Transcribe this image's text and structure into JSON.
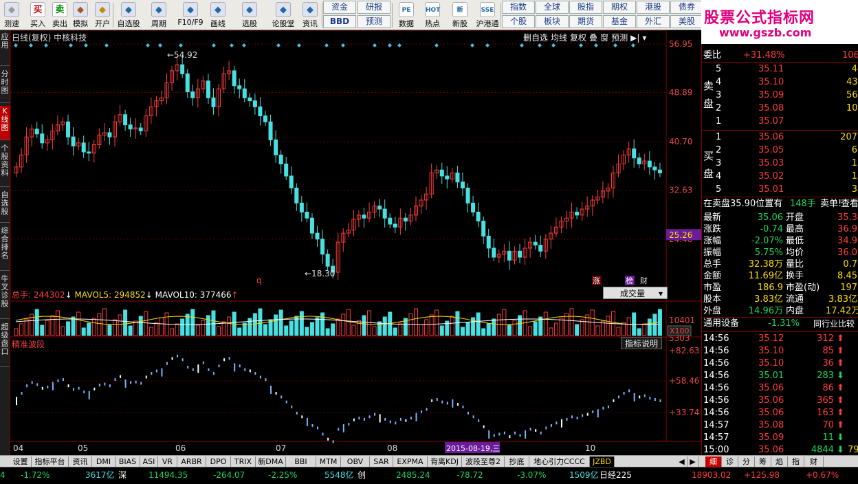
{
  "toolbar": {
    "buttons": [
      {
        "label": "测速",
        "icon": "speed-icon"
      },
      {
        "label": "买入",
        "icon": "buy-icon",
        "glyph": "买"
      },
      {
        "label": "卖出",
        "icon": "sell-icon",
        "glyph": "卖"
      },
      {
        "label": "模拟",
        "icon": "hammer-icon"
      },
      {
        "label": "开户",
        "icon": "lock-icon"
      },
      {
        "label": "自选股",
        "icon": "star-icon"
      },
      {
        "label": "周期",
        "icon": "clock-icon"
      },
      {
        "label": "F10/F9",
        "icon": "f10-icon"
      },
      {
        "label": "画线",
        "icon": "pen-icon"
      },
      {
        "label": "选股",
        "icon": "screen-icon"
      },
      {
        "label": "论股堂",
        "icon": "forum-icon"
      },
      {
        "label": "资讯",
        "icon": "news-icon"
      }
    ],
    "small_row1": [
      "资金",
      "研报"
    ],
    "small_row2": [
      "BBD",
      "预测"
    ],
    "buttons2": [
      {
        "label": "数据",
        "glyph": "PE"
      },
      {
        "label": "热点",
        "glyph": "HOT"
      },
      {
        "label": "新股",
        "glyph": "新"
      },
      {
        "label": "沪港通",
        "glyph": "SSE"
      }
    ],
    "grid_row1": [
      "指数",
      "全球",
      "股指",
      "期权",
      "港股",
      "债券"
    ],
    "grid_row2": [
      "个股",
      "板块",
      "期货",
      "基金",
      "外汇",
      "美股"
    ]
  },
  "watermark": {
    "title": "股票公式指标网",
    "url": "www.gszb.com"
  },
  "left_nav": [
    "应用",
    "分时图",
    "K线图",
    "个股资料",
    "自选股",
    "综合排名",
    "牛叉诊股",
    "超级盘口"
  ],
  "chart": {
    "header": "日线(复权) 中核科技",
    "tools": [
      "删自选",
      "均线",
      "复权",
      "叠",
      "窗",
      "预测"
    ],
    "max_label": "54.92",
    "min_label": "18.30",
    "price_axis": [
      "56.95",
      "48.89",
      "40.70",
      "32.63",
      "24.48"
    ],
    "current_price": "25.26",
    "markers": {
      "q": "q",
      "zhang": "涨",
      "bang": "榜",
      "cai": "财"
    },
    "volume_legend": {
      "total": "总手: 244302",
      "ma5": "MAVOL5: 294852",
      "ma10": "MAVOL10: 377466"
    },
    "volume_select": "成交量",
    "volume_axis": [
      "10401",
      "5303"
    ],
    "volume_unit": "X100",
    "indicator_title": "精准波段",
    "indicator_help": "指标说明",
    "indicator_axis": [
      "+82.63",
      "+58.46",
      "+33.74"
    ],
    "date_axis": [
      "04",
      "05",
      "06",
      "07",
      "08",
      "10"
    ],
    "date_cursor": "2015-08-19,三"
  },
  "panel": {
    "weibi": {
      "label": "委比",
      "value": "+31.48%",
      "extra": "106"
    },
    "sell_label": "卖盘",
    "buy_label": "买盘",
    "sell": [
      {
        "lv": "5",
        "price": "35.11",
        "vol": "4"
      },
      {
        "lv": "4",
        "price": "35.10",
        "vol": "43"
      },
      {
        "lv": "3",
        "price": "35.09",
        "vol": "56"
      },
      {
        "lv": "2",
        "price": "35.08",
        "vol": "10"
      },
      {
        "lv": "1",
        "price": "35.07",
        "vol": ""
      }
    ],
    "buy": [
      {
        "lv": "1",
        "price": "35.06",
        "vol": "207"
      },
      {
        "lv": "2",
        "price": "35.05",
        "vol": "6"
      },
      {
        "lv": "3",
        "price": "35.03",
        "vol": "1"
      },
      {
        "lv": "4",
        "price": "35.02",
        "vol": "1"
      },
      {
        "lv": "5",
        "price": "35.01",
        "vol": "3"
      }
    ],
    "notice": {
      "text": "在卖盘35.90位置有",
      "vol": "148手",
      "sell": "卖单!",
      "see": "查看详"
    },
    "stats": [
      [
        "最新",
        "35.06",
        "开盘",
        "35.3"
      ],
      [
        "涨跌",
        "-0.74",
        "最高",
        "36.9"
      ],
      [
        "涨幅",
        "-2.07%",
        "最低",
        "34.9"
      ],
      [
        "振幅",
        "5.75%",
        "均价",
        "36.0"
      ],
      [
        "总手",
        "32.38万",
        "量比",
        "0.7"
      ],
      [
        "金额",
        "11.69亿",
        "换手",
        "8.45"
      ],
      [
        "市盈",
        "186.9",
        "市盈(动)",
        "197"
      ],
      [
        "股本",
        "3.83亿",
        "流通",
        "3.83亿"
      ],
      [
        "外盘",
        "14.96万",
        "内盘",
        "17.42万"
      ]
    ],
    "industry": {
      "label": "通用设备",
      "pct": "-1.31%",
      "compare": "同行业比较"
    },
    "ticks": [
      {
        "t": "14:56",
        "p": "35.12",
        "v": "312",
        "d": "up"
      },
      {
        "t": "14:56",
        "p": "35.10",
        "v": "85",
        "d": "up"
      },
      {
        "t": "14:56",
        "p": "35.10",
        "v": "36",
        "d": "up"
      },
      {
        "t": "14:56",
        "p": "35.01",
        "v": "283",
        "d": "down"
      },
      {
        "t": "14:56",
        "p": "35.06",
        "v": "86",
        "d": "up"
      },
      {
        "t": "14:56",
        "p": "35.06",
        "v": "365",
        "d": "up"
      },
      {
        "t": "14:56",
        "p": "35.06",
        "v": "163",
        "d": "up"
      },
      {
        "t": "14:57",
        "p": "35.08",
        "v": "70",
        "d": "up"
      },
      {
        "t": "14:57",
        "p": "35.09",
        "v": "11",
        "d": "down"
      },
      {
        "t": "15:00",
        "p": "35.06",
        "v": "4844",
        "d": "down",
        "extra": "79"
      }
    ],
    "bottom_tabs": [
      "细",
      "诊",
      "分",
      "筹",
      "焰",
      "指",
      "财"
    ]
  },
  "indicator_tabs": [
    "设置",
    "指标平台",
    "资讯",
    "DMI",
    "BIAS",
    "ASI",
    "VR",
    "ARBR",
    "DPO",
    "TRIX",
    "新DMA",
    "BBI",
    "MTM",
    "OBV",
    "SAR",
    "EXPMA",
    "背离KDJ",
    "波段至尊2",
    "抄底",
    "地心引力CCCC",
    "JZBD"
  ],
  "status": [
    {
      "text": "4",
      "c": "grn"
    },
    {
      "text": "-1.72%",
      "c": "grn"
    },
    {
      "text": "3617亿",
      "c": "cyn"
    },
    {
      "text": "深",
      "c": "wht"
    },
    {
      "text": "11494.35",
      "c": "grn"
    },
    {
      "text": "-264.07",
      "c": "grn"
    },
    {
      "text": "-2.25%",
      "c": "grn"
    },
    {
      "text": "5548亿",
      "c": "cyn"
    },
    {
      "text": "创",
      "c": "wht"
    },
    {
      "text": "2485.24",
      "c": "grn"
    },
    {
      "text": "-78.72",
      "c": "grn"
    },
    {
      "text": "-3.07%",
      "c": "grn"
    },
    {
      "text": "1509亿",
      "c": "cyn"
    },
    {
      "text": "日经225",
      "c": "wht"
    },
    {
      "text": "18903.02",
      "c": "red"
    },
    {
      "text": "+125.98",
      "c": "red"
    },
    {
      "text": "+0.67%",
      "c": "red"
    }
  ]
}
